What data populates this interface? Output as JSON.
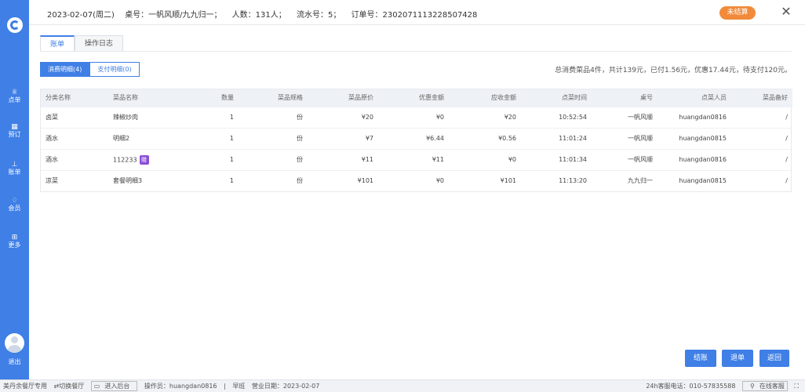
{
  "sidebar": {
    "items": [
      {
        "label": "点单",
        "icon": "cup-icon"
      },
      {
        "label": "预订",
        "icon": "calendar-icon"
      },
      {
        "label": "账单",
        "icon": "bar-chart-icon"
      },
      {
        "label": "会员",
        "icon": "diamond-icon"
      },
      {
        "label": "更多",
        "icon": "grid-icon"
      }
    ],
    "logout": "退出"
  },
  "header": {
    "date": "2023-02-07(周二)",
    "table": "桌号：一帆风顺/九九归一；",
    "people": "人数：131人；",
    "serial": "流水号：5；",
    "order": "订单号：2302071113228507428",
    "status": "未结算",
    "close": "✕"
  },
  "tabs": [
    "账单",
    "操作日志"
  ],
  "segments": [
    "消费明细(4)",
    "支付明细(0)"
  ],
  "summary": "总消费菜品4件，共计139元，已付1.56元，优惠17.44元，待支付120元。",
  "table": {
    "headers": [
      "分类名称",
      "菜品名称",
      "数量",
      "菜品规格",
      "菜品原价",
      "优惠金额",
      "应收金额",
      "点菜时间",
      "桌号",
      "点菜人员",
      "菜品备好"
    ],
    "rows": [
      [
        "卤菜",
        "辣椒炒肉",
        "1",
        "份",
        "¥20",
        "¥0",
        "¥20",
        "10:52:54",
        "一帆风顺",
        "huangdan0816",
        "/"
      ],
      [
        "酒水",
        "明细2",
        "1",
        "份",
        "¥7",
        "¥6.44",
        "¥0.56",
        "11:01:24",
        "一帆风顺",
        "huangdan0815",
        "/"
      ],
      [
        "酒水",
        "112233",
        "1",
        "份",
        "¥11",
        "¥11",
        "¥0",
        "11:01:34",
        "一帆风顺",
        "huangdan0816",
        "/"
      ],
      [
        "凉菜",
        "套餐明细3",
        "1",
        "份",
        "¥101",
        "¥0",
        "¥101",
        "11:13:20",
        "九九归一",
        "huangdan0815",
        "/"
      ]
    ],
    "gift_label": "赠"
  },
  "actions": [
    "结账",
    "退单",
    "返回"
  ],
  "footer": {
    "mode": "美丹余餐厅专用",
    "switch": "⇄切换餐厅",
    "enter": "进入后台",
    "operator": "操作员：huangdan0816",
    "shift": "早班",
    "business_date": "营业日期：2023-02-07",
    "hotline": "24h客服电话：010-57835588",
    "online": "在线客服"
  },
  "colors": {
    "primary": "#3f7fe6",
    "status": "#f28a3a",
    "gift": "#8a4fd6"
  }
}
